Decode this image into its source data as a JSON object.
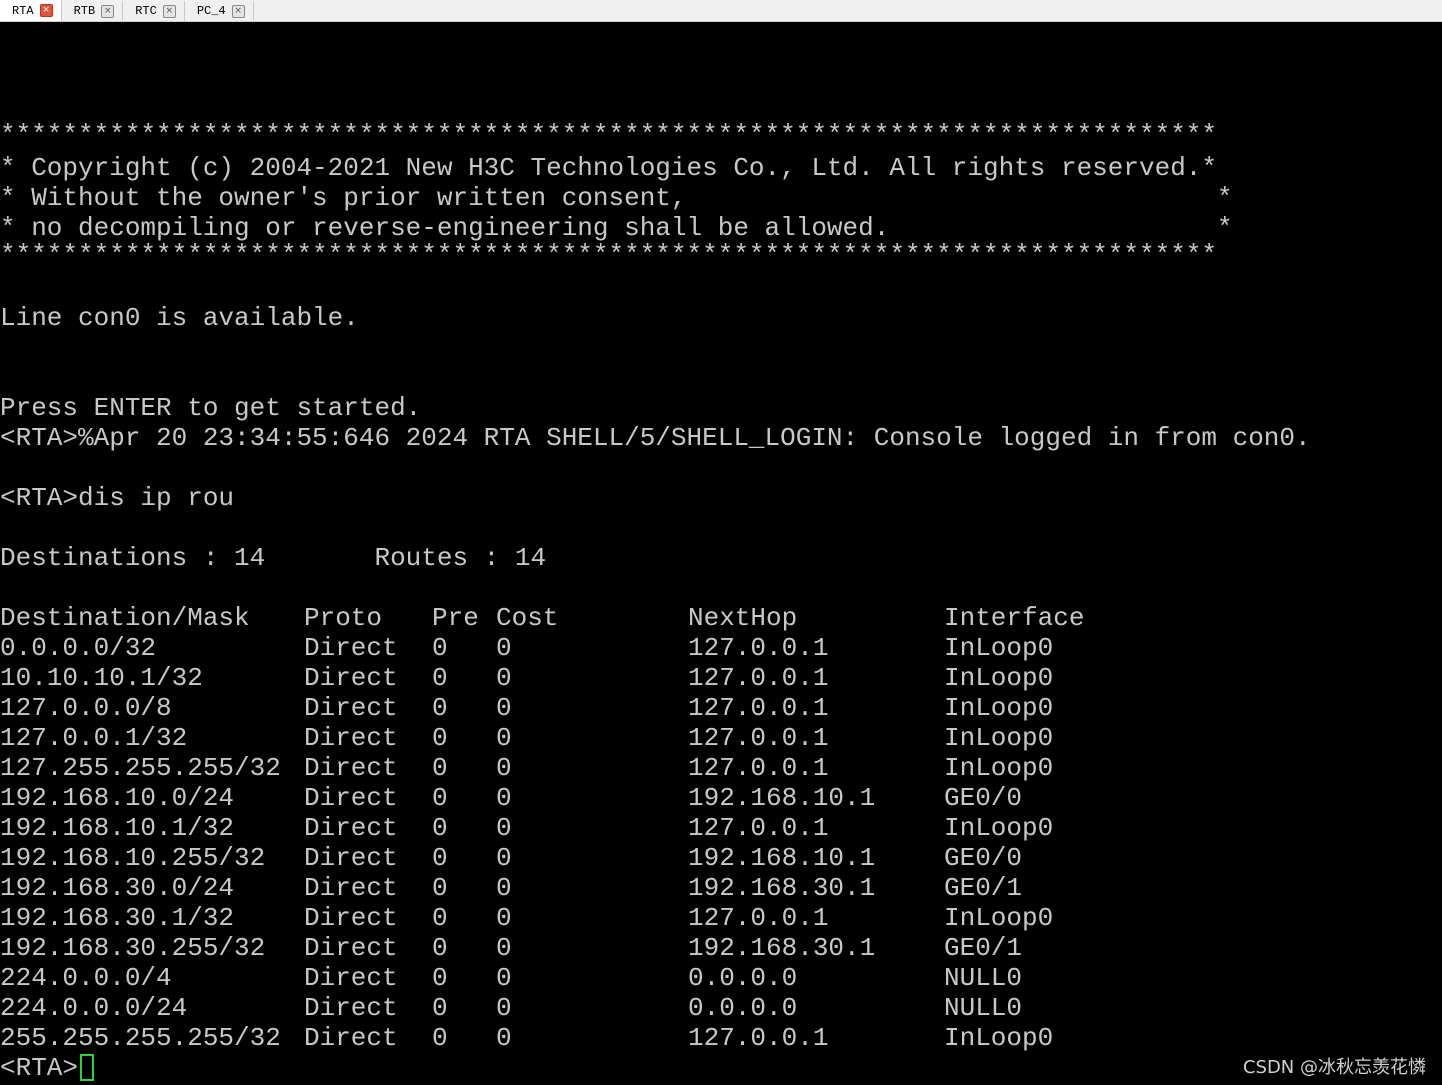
{
  "tabs": [
    {
      "label": "RTA",
      "active": true
    },
    {
      "label": "RTB",
      "active": false
    },
    {
      "label": "RTC",
      "active": false
    },
    {
      "label": "PC_4",
      "active": false
    }
  ],
  "banner": {
    "border": "******************************************************************************",
    "line1": "* Copyright (c) 2004-2021 New H3C Technologies Co., Ltd. All rights reserved.*",
    "line2": "* Without the owner's prior written consent,                                  *",
    "line3": "* no decompiling or reverse-engineering shall be allowed.                     *"
  },
  "console": {
    "line_avail": "Line con0 is available.",
    "press_enter": "Press ENTER to get started.",
    "login_msg": "<RTA>%Apr 20 23:34:55:646 2024 RTA SHELL/5/SHELL_LOGIN: Console logged in from con0.",
    "command": "<RTA>dis ip rou",
    "summary": "Destinations : 14       Routes : 14",
    "prompt": "<RTA>"
  },
  "route_table": {
    "headers": {
      "destination": "Destination/Mask",
      "proto": "Proto",
      "pre": "Pre",
      "cost": "Cost",
      "nexthop": "NextHop",
      "interface": "Interface"
    },
    "rows": [
      [
        "0.0.0.0/32",
        "Direct",
        "0",
        "0",
        "127.0.0.1",
        "InLoop0"
      ],
      [
        "10.10.10.1/32",
        "Direct",
        "0",
        "0",
        "127.0.0.1",
        "InLoop0"
      ],
      [
        "127.0.0.0/8",
        "Direct",
        "0",
        "0",
        "127.0.0.1",
        "InLoop0"
      ],
      [
        "127.0.0.1/32",
        "Direct",
        "0",
        "0",
        "127.0.0.1",
        "InLoop0"
      ],
      [
        "127.255.255.255/32",
        "Direct",
        "0",
        "0",
        "127.0.0.1",
        "InLoop0"
      ],
      [
        "192.168.10.0/24",
        "Direct",
        "0",
        "0",
        "192.168.10.1",
        "GE0/0"
      ],
      [
        "192.168.10.1/32",
        "Direct",
        "0",
        "0",
        "127.0.0.1",
        "InLoop0"
      ],
      [
        "192.168.10.255/32",
        "Direct",
        "0",
        "0",
        "192.168.10.1",
        "GE0/0"
      ],
      [
        "192.168.30.0/24",
        "Direct",
        "0",
        "0",
        "192.168.30.1",
        "GE0/1"
      ],
      [
        "192.168.30.1/32",
        "Direct",
        "0",
        "0",
        "127.0.0.1",
        "InLoop0"
      ],
      [
        "192.168.30.255/32",
        "Direct",
        "0",
        "0",
        "192.168.30.1",
        "GE0/1"
      ],
      [
        "224.0.0.0/4",
        "Direct",
        "0",
        "0",
        "0.0.0.0",
        "NULL0"
      ],
      [
        "224.0.0.0/24",
        "Direct",
        "0",
        "0",
        "0.0.0.0",
        "NULL0"
      ],
      [
        "255.255.255.255/32",
        "Direct",
        "0",
        "0",
        "127.0.0.1",
        "InLoop0"
      ]
    ]
  },
  "watermark": "CSDN @冰秋忘羡花憐",
  "colors": {
    "background": "#000000",
    "text": "#c8c8c8",
    "cursor": "#2bd43a"
  }
}
